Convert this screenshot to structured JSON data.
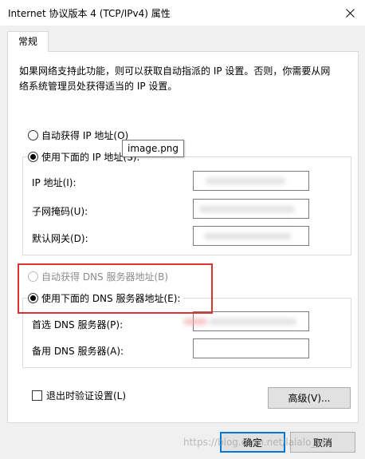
{
  "window": {
    "title": "Internet 协议版本 4 (TCP/IPv4) 属性",
    "close_glyph": "✕"
  },
  "tabs": [
    {
      "label": "常规"
    }
  ],
  "description_line1": "如果网络支持此功能，则可以获取自动指派的 IP 设置。否则，你需要从网",
  "description_line2": "络系统管理员处获得适当的 IP 设置。",
  "ip_options": {
    "auto_label": "自动获得 IP 地址(O)",
    "manual_label": "使用下面的 IP 地址(S):"
  },
  "ip_fields": [
    {
      "label": "IP 地址(I):",
      "value": ""
    },
    {
      "label": "子网掩码(U):",
      "value": ""
    },
    {
      "label": "默认网关(D):",
      "value": ""
    }
  ],
  "tooltip": {
    "text": "image.png"
  },
  "dns_options": {
    "auto_label": "自动获得 DNS 服务器地址(B)",
    "manual_label": "使用下面的 DNS 服务器地址(E):"
  },
  "dns_fields": [
    {
      "label": "首选 DNS 服务器(P):",
      "value": ""
    },
    {
      "label": "备用 DNS 服务器(A):",
      "value": ""
    }
  ],
  "validate_checkbox": {
    "label": "退出时验证设置(L)",
    "checked": false
  },
  "buttons": {
    "advanced": "高级(V)...",
    "ok": "确定",
    "cancel": "取消"
  },
  "watermark": {
    "text": "https://blog.csdn.net/lalalo_xf"
  },
  "colors": {
    "highlight_border": "#e03131",
    "default_button_border": "#0078d7"
  }
}
